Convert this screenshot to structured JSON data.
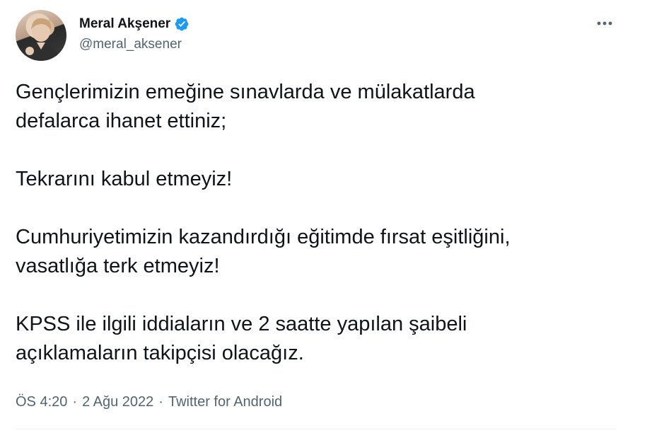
{
  "author": {
    "display_name": "Meral Akşener",
    "handle": "@meral_aksener",
    "verified_color": "#1d9bf0"
  },
  "tweet": {
    "paragraphs": [
      "Gençlerimizin emeğine sınavlarda ve mülakatlarda\ndefalarca ihanet ettiniz;",
      "Tekrarını kabul etmeyiz!",
      "Cumhuriyetimizin kazandırdığı eğitimde fırsat eşitliğini,\nvasatlığa terk etmeyiz!",
      "KPSS ile ilgili iddiaların ve 2 saatte yapılan şaibeli\naçıklamaların takipçisi olacağız."
    ],
    "time": "ÖS 4:20",
    "date": "2 Ağu 2022",
    "source": "Twitter for Android",
    "separator": "·"
  },
  "icons": {
    "verified": "verified-badge-icon",
    "more": "more-horizontal-icon"
  }
}
